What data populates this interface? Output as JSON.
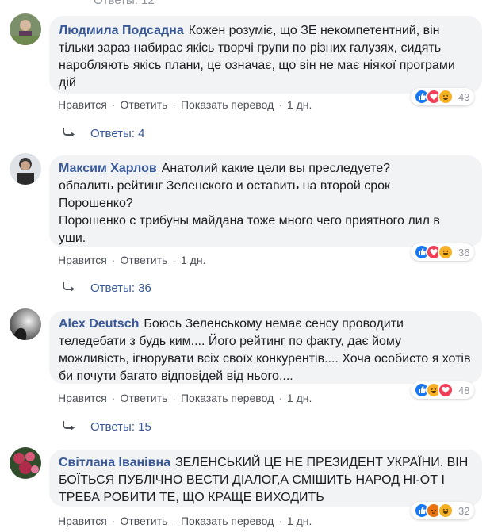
{
  "top_partial": "Ответы: 12",
  "comments": [
    {
      "author": "Людмила Подсадна",
      "text": "Кожен розуміє, що ЗЕ некомпетентний, він тільки зараз набирає якісь творчі групи по різних галузях, сидять наробляють якісь плани, це означає, що він не має ніякої програми дій",
      "like": "Нравится",
      "reply": "Ответить",
      "translate": "Показать перевод",
      "time": "1 дн.",
      "reaction_count": "43",
      "reactions": [
        "like-icon",
        "love-icon",
        "haha-icon"
      ],
      "replies": "Ответы: 4"
    },
    {
      "author": "Максим Харлов",
      "text_lines": [
        "Анатолий какие цели вы преследуете?",
        "обвалить рейтинг Зеленского и оставить на второй срок",
        "Порошенко?",
        "Порошенко с трибуны майдана тоже много чего приятного лил в",
        "уши."
      ],
      "like": "Нравится",
      "reply": "Ответить",
      "time": "1 дн.",
      "reaction_count": "36",
      "reactions": [
        "like-icon",
        "love-icon",
        "haha-icon"
      ],
      "replies": "Ответы: 36"
    },
    {
      "author": "Alex Deutsch",
      "text": "Боюсь Зеленському немає сенсу проводити теледебати з будь ким.... Його рейтинг по факту, дає йому можливість, ігнорувати всіх своїх конкурентів.... Хоча особисто я хотів би почути багато відповідей від нього....",
      "like": "Нравится",
      "reply": "Ответить",
      "translate": "Показать перевод",
      "time": "1 дн.",
      "reaction_count": "48",
      "reactions": [
        "like-icon",
        "haha-icon",
        "love-icon"
      ],
      "replies": "Ответы: 15"
    },
    {
      "author": "Світлана Іванівна",
      "text": "ЗЕЛЕНСЬКИЙ ЦЕ НЕ ПРЕЗИДЕНТ УКРАЇНИ. ВІН БОЇТЬСЯ ПУБЛІЧНО ВЕСТИ ДІАЛОГ,А СМІШИТЬ НАРОД НІ-ОТ І ТРЕБА РОБИТИ ТЕ, ЩО КРАЩЕ ВИХОДИТЬ",
      "like": "Нравится",
      "reply": "Ответить",
      "translate": "Показать перевод",
      "time": "1 дн.",
      "reaction_count": "32",
      "reactions": [
        "like-icon",
        "angry-icon",
        "haha-icon"
      ]
    }
  ]
}
